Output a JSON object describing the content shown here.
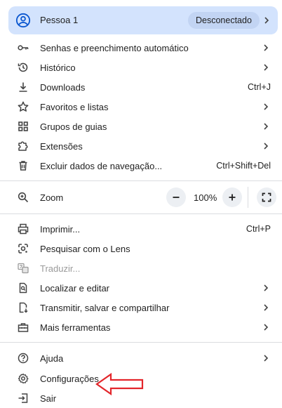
{
  "profile": {
    "name": "Pessoa 1",
    "status": "Desconectado"
  },
  "items": [
    {
      "label": "Senhas e preenchimento automático"
    },
    {
      "label": "Histórico"
    },
    {
      "label": "Downloads",
      "shortcut": "Ctrl+J"
    },
    {
      "label": "Favoritos e listas"
    },
    {
      "label": "Grupos de guias"
    },
    {
      "label": "Extensões"
    },
    {
      "label": "Excluir dados de navegação...",
      "shortcut": "Ctrl+Shift+Del"
    }
  ],
  "zoom": {
    "label": "Zoom",
    "minus": "−",
    "value": "100%",
    "plus": "+"
  },
  "tools": [
    {
      "label": "Imprimir...",
      "shortcut": "Ctrl+P"
    },
    {
      "label": "Pesquisar com o Lens"
    },
    {
      "label": "Traduzir..."
    },
    {
      "label": "Localizar e editar"
    },
    {
      "label": "Transmitir, salvar e compartilhar"
    },
    {
      "label": "Mais ferramentas"
    }
  ],
  "footer": [
    {
      "label": "Ajuda"
    },
    {
      "label": "Configurações"
    },
    {
      "label": "Sair"
    }
  ],
  "colors": {
    "profile_bg": "#d3e3fd",
    "badge_bg": "#c2d4f3",
    "annotation_arrow": "#e3262b",
    "avatar": "#0b57d0"
  }
}
